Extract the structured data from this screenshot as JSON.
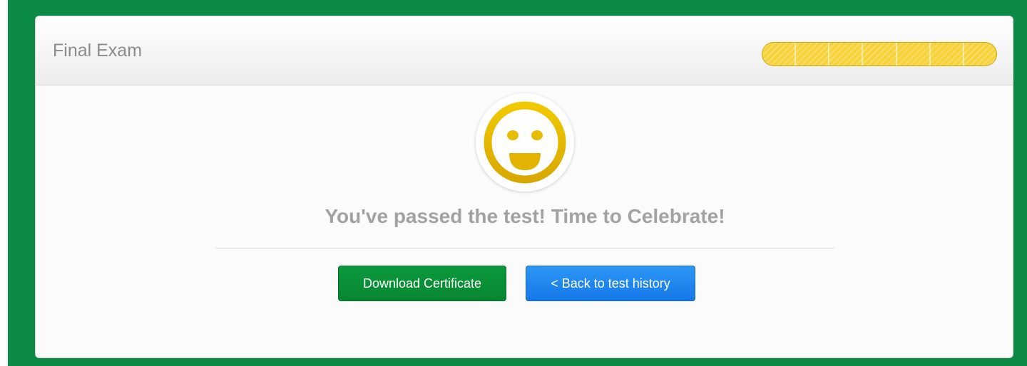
{
  "exam": {
    "title": "Final Exam",
    "progress_segments": 7,
    "progress_complete": 1.0
  },
  "result": {
    "icon": "smiley-face-icon",
    "message": "You've passed the test! Time to Celebrate!"
  },
  "actions": {
    "download_label": "Download Certificate",
    "back_label": "< Back to test history"
  },
  "colors": {
    "background": "#0a8a45",
    "progress_fill": "#f6d23b",
    "smiley": "#e0b400",
    "download_button": "#0b9a3c",
    "back_button": "#1e88f0"
  }
}
